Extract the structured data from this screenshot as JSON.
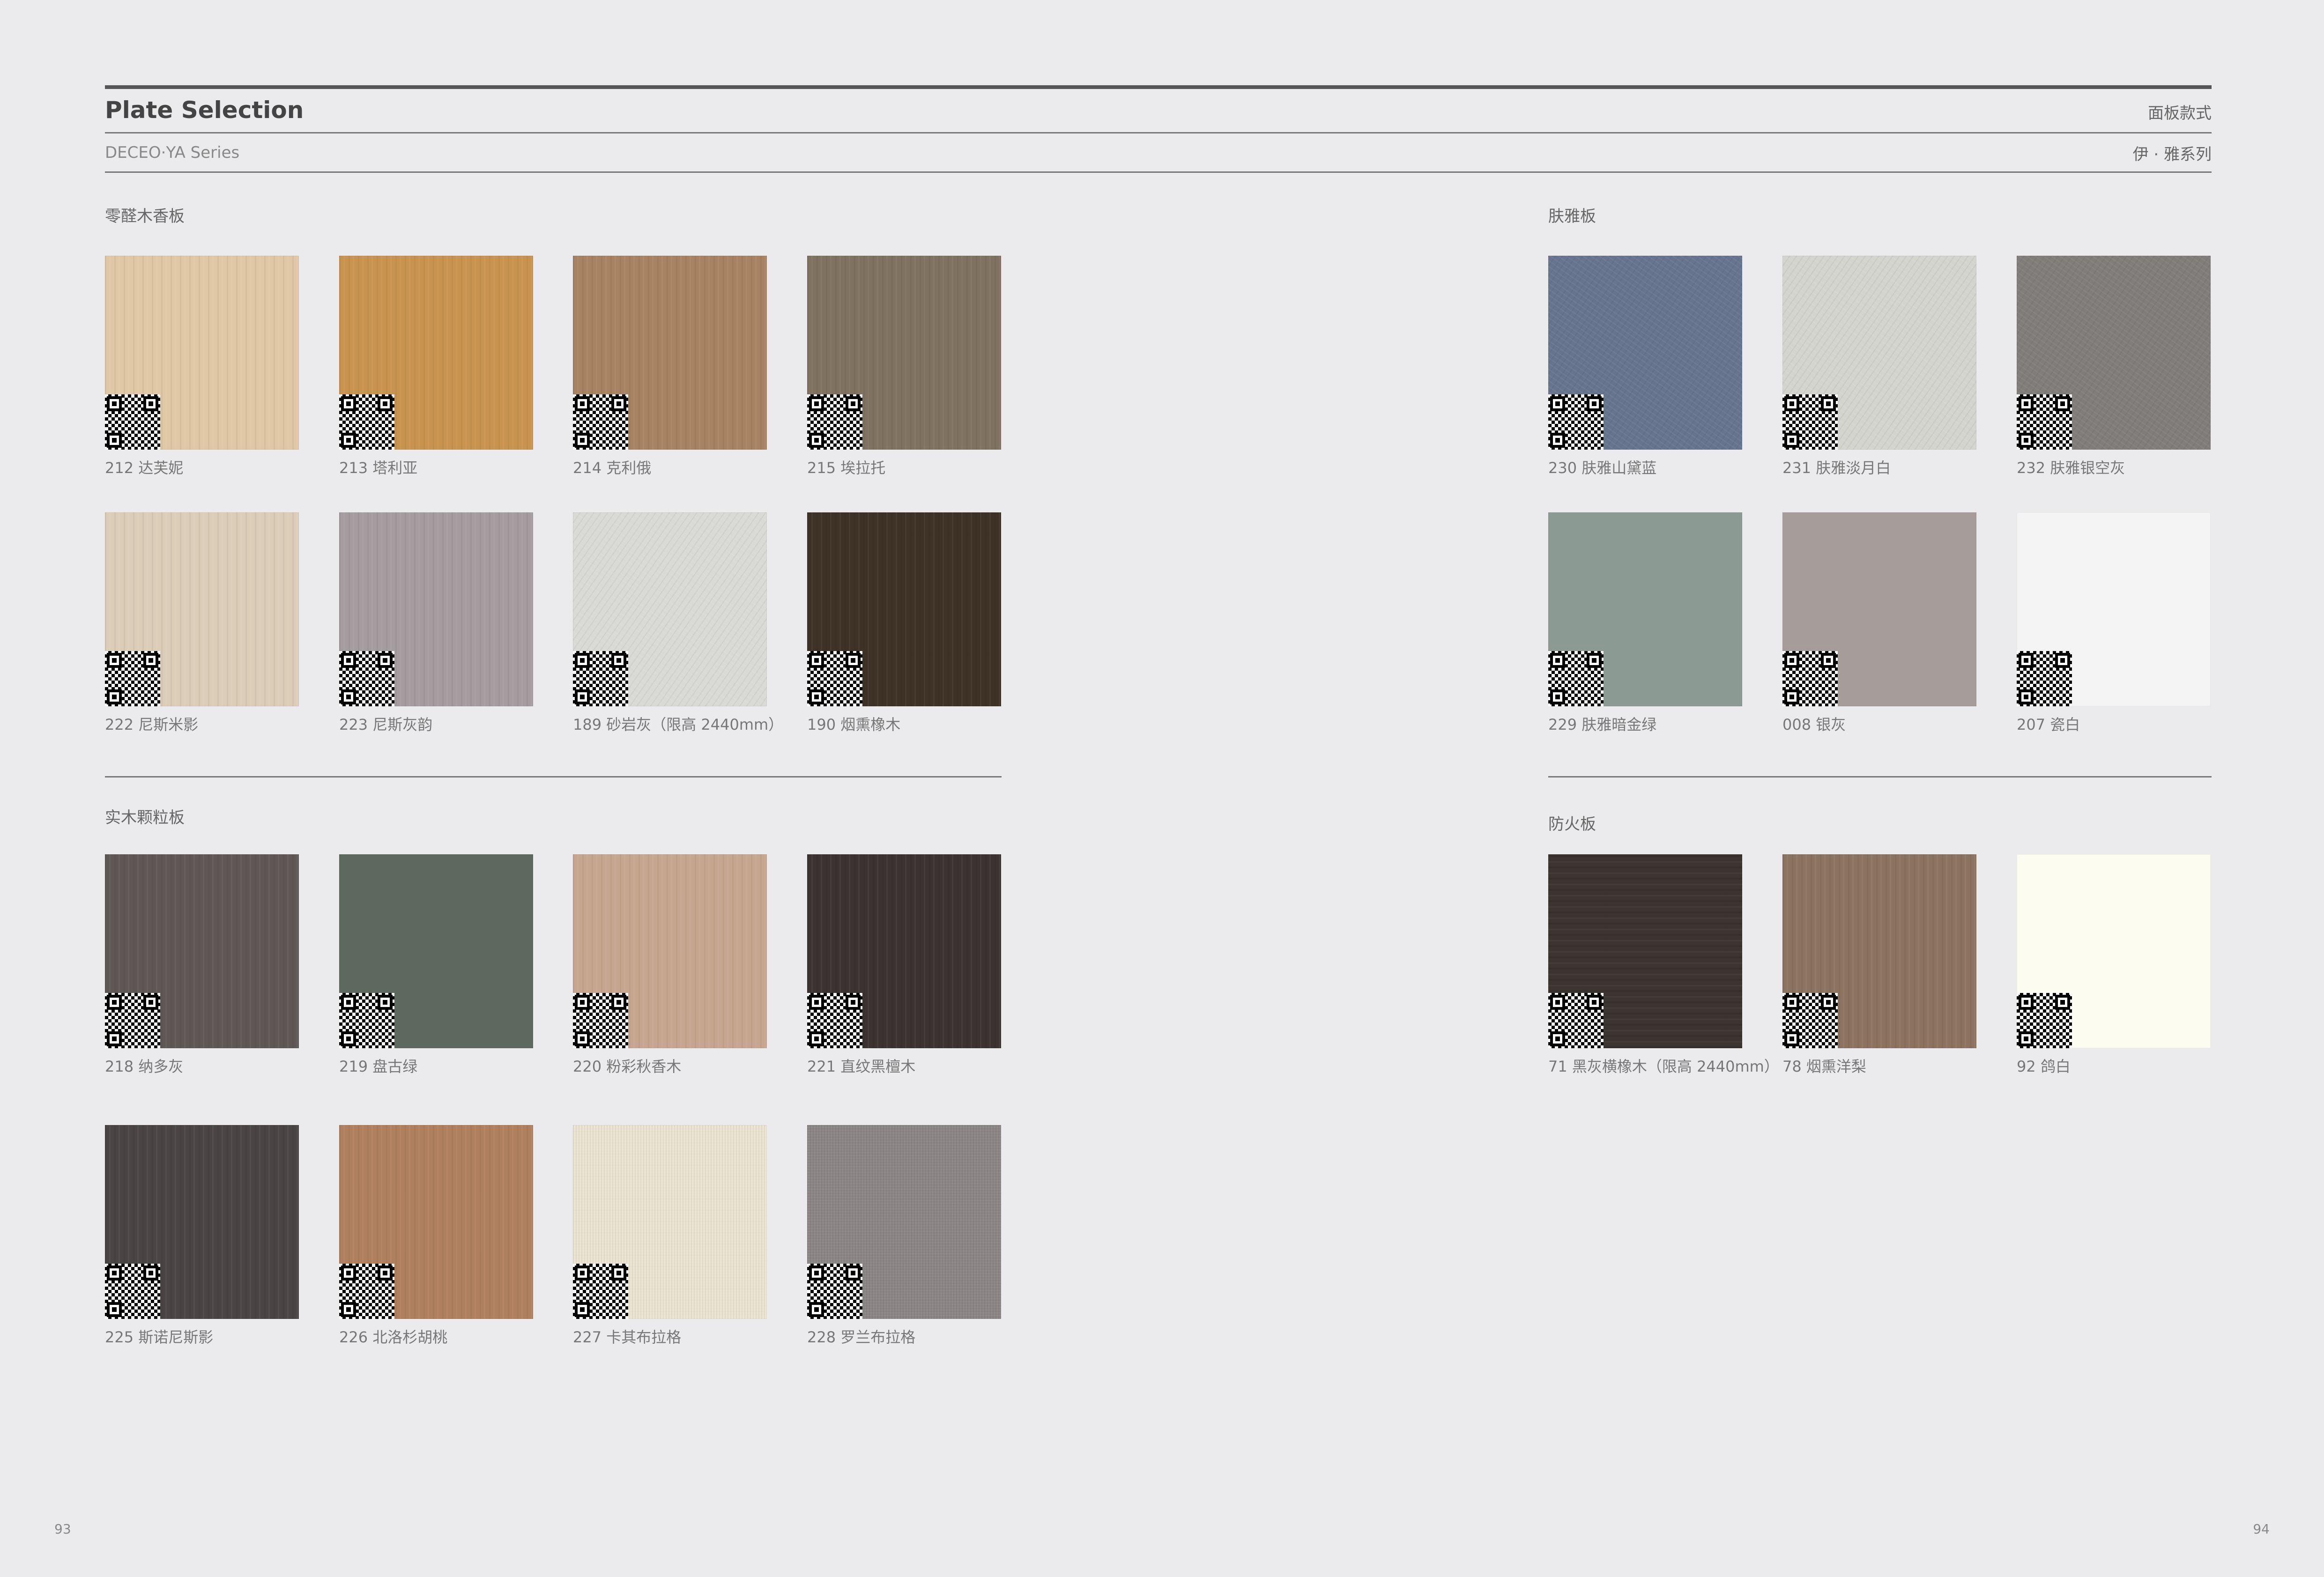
{
  "header": {
    "title": "Plate Selection",
    "title_cn": "面板款式",
    "series": "DECEO·YA Series",
    "series_cn": "伊 · 雅系列"
  },
  "sections": [
    {
      "title": "零醛木香板"
    },
    {
      "title": "实木颗粒板"
    },
    {
      "title": "肤雅板"
    },
    {
      "title": "防火板"
    }
  ],
  "swatches": [
    {
      "label": "212  达芙妮",
      "color": "#e0c8a6",
      "texture": "wood-v"
    },
    {
      "label": "213  塔利亚",
      "color": "#c8934f",
      "texture": "wood-v"
    },
    {
      "label": "214  克利俄",
      "color": "#a88363",
      "texture": "wood-v"
    },
    {
      "label": "215  埃拉托",
      "color": "#7f7260",
      "texture": "wood-v"
    },
    {
      "label": "222  尼斯米影",
      "color": "#dccdb8",
      "texture": "wood-v"
    },
    {
      "label": "223  尼斯灰韵",
      "color": "#a59ca0",
      "texture": "wood-v"
    },
    {
      "label": "189  砂岩灰（限高 2440mm）",
      "color": "#d9d9d5",
      "texture": "scratch"
    },
    {
      "label": "190  烟熏橡木",
      "color": "#3e3227",
      "texture": "wood-v"
    },
    {
      "label": "218  纳多灰",
      "color": "#5f5756",
      "texture": "wood-v"
    },
    {
      "label": "219  盘古绿",
      "color": "#5d695e",
      "texture": "none"
    },
    {
      "label": "220  粉彩秋香木",
      "color": "#c7a690",
      "texture": "wood-v"
    },
    {
      "label": "221  直纹黑檀木",
      "color": "#3b3231",
      "texture": "wood-v"
    },
    {
      "label": "225  斯诺尼斯影",
      "color": "#4a4444",
      "texture": "wood-v"
    },
    {
      "label": "226  北洛杉胡桃",
      "color": "#b0805e",
      "texture": "wood-v"
    },
    {
      "label": "227  卡其布拉格",
      "color": "#ece4d1",
      "texture": "fabric"
    },
    {
      "label": "228  罗兰布拉格",
      "color": "#8b8585",
      "texture": "fabric"
    },
    {
      "label": " 230  肤雅山黛蓝",
      "color": "#66758d",
      "texture": "scratch"
    },
    {
      "label": "231  肤雅淡月白",
      "color": "#d4d4cf",
      "texture": "scratch"
    },
    {
      "label": "232  肤雅银空灰",
      "color": "#807d7a",
      "texture": "scratch"
    },
    {
      "label": "229  肤雅暗金绿",
      "color": "#8b9a92",
      "texture": "none"
    },
    {
      "label": "008  银灰",
      "color": "#a69c99",
      "texture": "none"
    },
    {
      "label": "207  瓷白",
      "color": "#f4f4f5",
      "texture": "none"
    },
    {
      "label": "71  黑灰横橡木（限高 2440mm）",
      "color": "#3b3431",
      "texture": "wood-h"
    },
    {
      "label": "78  烟熏洋梨",
      "color": "#8b735f",
      "texture": "wood-v"
    },
    {
      "label": "92  鸽白",
      "color": "#fdfcf1",
      "texture": "none"
    }
  ],
  "pages": {
    "left": "93",
    "right": "94"
  }
}
